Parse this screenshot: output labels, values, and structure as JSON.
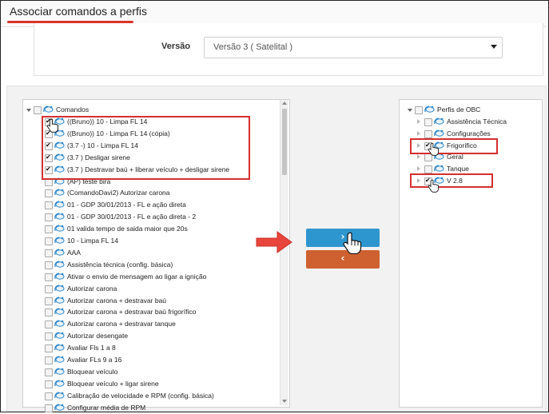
{
  "header": {
    "title": "Associar comandos a perfis"
  },
  "version": {
    "label": "Versão",
    "selected": "Versão 3 ( Satelital )"
  },
  "left_tree": {
    "root": "Comandos",
    "items": [
      {
        "label": "((Bruno)) 10 - Limpa FL 14",
        "checked": true
      },
      {
        "label": "((Bruno)) 10 - Limpa FL 14 (cópia)",
        "checked": true
      },
      {
        "label": "(3.7 -) 10 - Limpa FL 14",
        "checked": true
      },
      {
        "label": "(3.7 ) Desligar sirene",
        "checked": true
      },
      {
        "label": "(3.7 ) Destravar baú + liberar veículo + desligar sirene",
        "checked": true
      },
      {
        "label": "(AP) teste bira",
        "checked": false
      },
      {
        "label": "(ComandoDavi2) Autorizar carona",
        "checked": false
      },
      {
        "label": "01 - GDP 30/01/2013 - FL e ação direta",
        "checked": false
      },
      {
        "label": "01 - GDP 30/01/2013 - FL e ação direta - 2",
        "checked": false
      },
      {
        "label": "01 valida tempo de saida maior que 20s",
        "checked": false
      },
      {
        "label": "10 - Limpa FL 14",
        "checked": false
      },
      {
        "label": "AAA",
        "checked": false
      },
      {
        "label": "Assistência técnica (config. básica)",
        "checked": false
      },
      {
        "label": "Ativar o envio de mensagem ao ligar a ignição",
        "checked": false
      },
      {
        "label": "Autorizar carona",
        "checked": false
      },
      {
        "label": "Autorizar carona + destravar baú",
        "checked": false
      },
      {
        "label": "Autorizar carona + destravar baú frigorífico",
        "checked": false
      },
      {
        "label": "Autorizar carona + destravar tanque",
        "checked": false
      },
      {
        "label": "Autorizar desengate",
        "checked": false
      },
      {
        "label": "Avaliar Fls 1 a 8",
        "checked": false
      },
      {
        "label": "Avaliar FLs 9 a 16",
        "checked": false
      },
      {
        "label": "Bloquear veículo",
        "checked": false
      },
      {
        "label": "Bloquear veículo + ligar sirene",
        "checked": false
      },
      {
        "label": "Calibração de velocidade e RPM (config. básica)",
        "checked": false
      },
      {
        "label": "Configurar média de RPM",
        "checked": false
      }
    ]
  },
  "right_tree": {
    "root": "Perfis de OBC",
    "items": [
      {
        "label": "Assistência Técnica",
        "checked": false
      },
      {
        "label": "Configurações",
        "checked": false
      },
      {
        "label": "Frigorífico",
        "checked": true
      },
      {
        "label": "Geral",
        "checked": false
      },
      {
        "label": "Tanque",
        "checked": false
      },
      {
        "label": "V 2.8",
        "checked": true
      }
    ]
  },
  "buttons": {
    "forward_glyph": "›",
    "back_glyph": "‹"
  },
  "colors": {
    "accent_red": "#d52f2f",
    "forward_blue": "#2e96cf",
    "back_orange": "#cf6131",
    "icon_blue": "#2c86c9"
  },
  "icons": {
    "node_icon": "satellite-dish-icon",
    "pointer": "hand-pointer-icon",
    "annotation": "red-arrow-icon"
  }
}
